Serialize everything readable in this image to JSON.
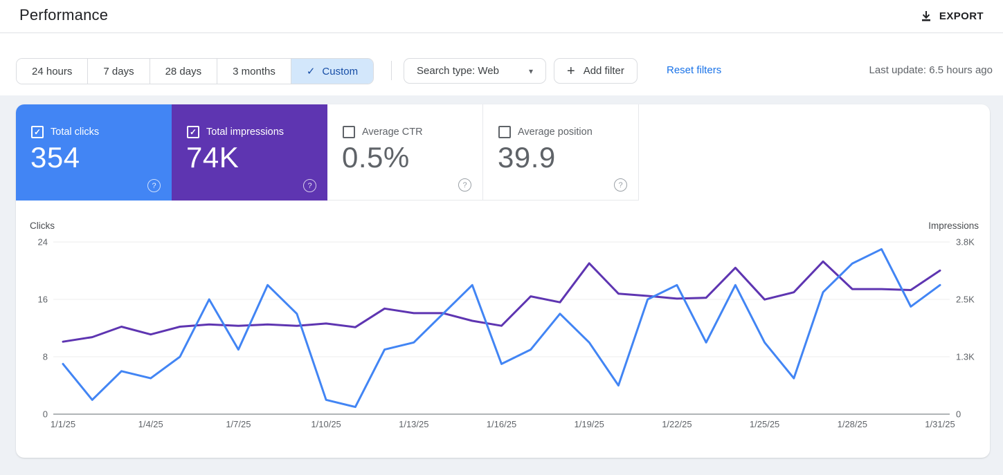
{
  "page": {
    "title": "Performance",
    "export_label": "EXPORT"
  },
  "filters": {
    "date_ranges": [
      "24 hours",
      "7 days",
      "28 days",
      "3 months",
      "Custom"
    ],
    "selected_range": "Custom",
    "check_glyph": "✓",
    "search_type_label": "Search type: Web",
    "caret_glyph": "▾",
    "plus_glyph": "+",
    "add_filter_label": "Add filter",
    "reset_label": "Reset filters",
    "last_update": "Last update: 6.5 hours ago"
  },
  "metrics": [
    {
      "label": "Total clicks",
      "value": "354",
      "checked": true,
      "color": "#4285f4"
    },
    {
      "label": "Total impressions",
      "value": "74K",
      "checked": true,
      "color": "#5e35b1"
    },
    {
      "label": "Average CTR",
      "value": "0.5%",
      "checked": false,
      "color": "#ffffff"
    },
    {
      "label": "Average position",
      "value": "39.9",
      "checked": false,
      "color": "#ffffff"
    }
  ],
  "help_glyph": "?",
  "chart_data": {
    "type": "line",
    "x": [
      "1/1/25",
      "1/2/25",
      "1/3/25",
      "1/4/25",
      "1/5/25",
      "1/6/25",
      "1/7/25",
      "1/8/25",
      "1/9/25",
      "1/10/25",
      "1/11/25",
      "1/12/25",
      "1/13/25",
      "1/14/25",
      "1/15/25",
      "1/16/25",
      "1/17/25",
      "1/18/25",
      "1/19/25",
      "1/20/25",
      "1/21/25",
      "1/22/25",
      "1/23/25",
      "1/24/25",
      "1/25/25",
      "1/26/25",
      "1/27/25",
      "1/28/25",
      "1/29/25",
      "1/30/25",
      "1/31/25"
    ],
    "x_tick_days": [
      1,
      4,
      7,
      10,
      13,
      16,
      19,
      22,
      25,
      28,
      31
    ],
    "series": [
      {
        "name": "Clicks",
        "axis": "left",
        "color": "#4285f4",
        "values": [
          7,
          2,
          6,
          5,
          8,
          16,
          9,
          18,
          14,
          2,
          1,
          9,
          10,
          14,
          18,
          7,
          9,
          14,
          10,
          4,
          16,
          18,
          10,
          18,
          10,
          5,
          17,
          21,
          23,
          15,
          18
        ]
      },
      {
        "name": "Impressions",
        "axis": "right",
        "color": "#5e35b1",
        "values": [
          1600,
          1700,
          1930,
          1760,
          1930,
          1980,
          1950,
          1980,
          1950,
          2000,
          1920,
          2330,
          2230,
          2230,
          2060,
          1950,
          2600,
          2470,
          3330,
          2660,
          2610,
          2550,
          2570,
          3230,
          2530,
          2690,
          3370,
          2760,
          2760,
          2740,
          3170
        ]
      }
    ],
    "left_axis": {
      "label": "Clicks",
      "ticks": [
        0,
        8,
        16,
        24
      ],
      "max": 24
    },
    "right_axis": {
      "label": "Impressions",
      "tick_labels": [
        "0",
        "1.3K",
        "2.5K",
        "3.8K"
      ],
      "max": 3800
    },
    "grid": true,
    "legend_position": "none"
  }
}
